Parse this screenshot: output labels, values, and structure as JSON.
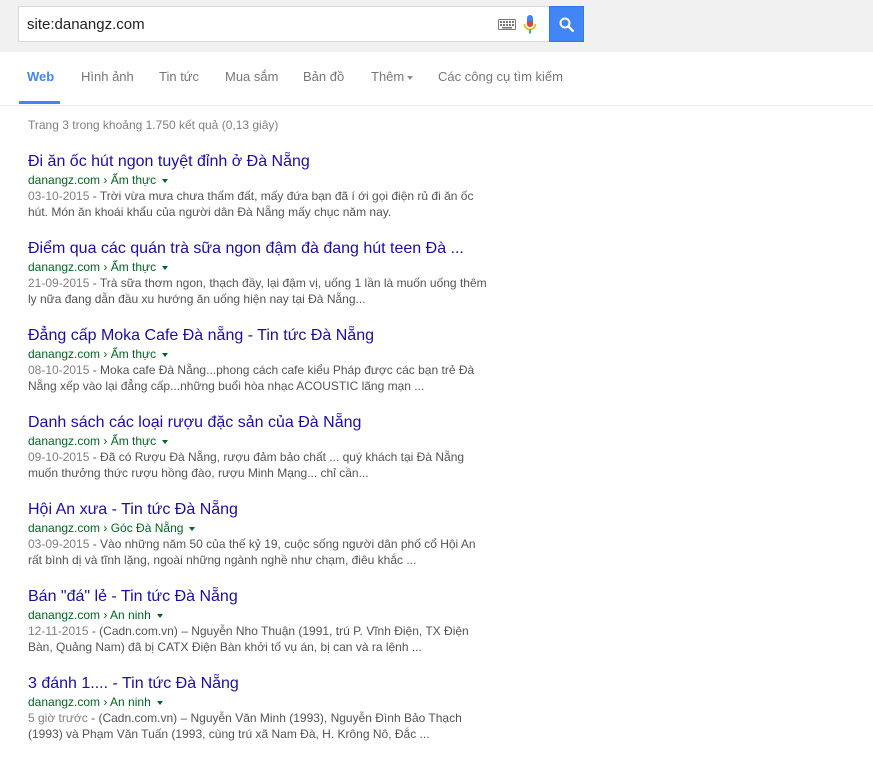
{
  "search": {
    "query": "site:danangz.com"
  },
  "nav": {
    "web": "Web",
    "images": "Hình ảnh",
    "news": "Tin tức",
    "shopping": "Mua sắm",
    "maps": "Bản đồ",
    "more": "Thêm",
    "tools": "Các công cụ tìm kiếm"
  },
  "stats": "Trang 3 trong khoảng 1.750 kết quả (0,13 giây)",
  "results": [
    {
      "title": "Đi ăn ốc hút ngon tuyệt đỉnh ở Đà Nẵng",
      "url": "danangz.com › Ẩm thực",
      "date": "03-10-2015",
      "snippet": " - Trời vừa mưa chưa thấm đất, mấy đứa bạn đã í ới gọi điện rủ đi ăn ốc hút. Món ăn khoái khẩu của người dân Đà Nẵng mấy chục năm nay."
    },
    {
      "title": "Điểm qua các quán trà sữa ngon đậm đà đang hút teen Đà ...",
      "url": "danangz.com › Ẩm thực",
      "date": "21-09-2015",
      "snippet": " - Trà sữa thơm ngon, thạch đầy, lại đậm vị, uống 1 lần là muốn uống thêm ly nữa đang dẫn đầu xu hướng ăn uống hiện nay tại Đà Nẵng..."
    },
    {
      "title": "Đẳng cấp Moka Cafe Đà nẵng - Tin tức Đà Nẵng",
      "url": "danangz.com › Ẩm thực",
      "date": "08-10-2015",
      "snippet": " - Moka cafe Đà Nẵng...phong cách cafe kiểu Pháp được các bạn trẻ Đà Nẵng xếp vào lại đẳng cấp...những buổi hòa nhạc ACOUSTIC lãng mạn ..."
    },
    {
      "title": "Danh sách các loại rượu đặc sản của Đà Nẵng",
      "url": "danangz.com › Ẩm thực",
      "date": "09-10-2015",
      "snippet": " - Đã có Rượu Đà Nẵng, rượu đảm bảo chất ... quý khách tại Đà Nẵng muốn thưởng thức rượu hồng đào, rượu Minh Mạng... chỉ cần..."
    },
    {
      "title": "Hội An xưa - Tin tức Đà Nẵng",
      "url": "danangz.com › Góc Đà Nẵng",
      "date": "03-09-2015",
      "snippet": " - Vào những năm 50 của thế kỷ 19, cuộc sống người dân phố cổ Hội An rất bình dị và tĩnh lặng, ngoài những ngành nghề như chạm, điêu khắc ..."
    },
    {
      "title": "Bán \"đá\" lẻ - Tin tức Đà Nẵng",
      "url": "danangz.com › An ninh",
      "date": "12-11-2015",
      "snippet": " - (Cadn.com.vn) – Nguyễn Nho Thuận (1991, trú P. Vĩnh Điện, TX Điện Bàn, Quảng Nam) đã bị CATX Điện Bàn khởi tố vụ án, bị can và ra lệnh ..."
    },
    {
      "title": "3 đánh 1.... - Tin tức Đà Nẵng",
      "url": "danangz.com › An ninh",
      "date": "5 giờ trước",
      "snippet": " - (Cadn.com.vn) – Nguyễn Văn Minh (1993), Nguyễn Đình Bảo Thạch (1993) và Phạm Văn Tuấn (1993, cùng trú xã Nam Đà, H. Krông Nô, Đắc ..."
    }
  ]
}
